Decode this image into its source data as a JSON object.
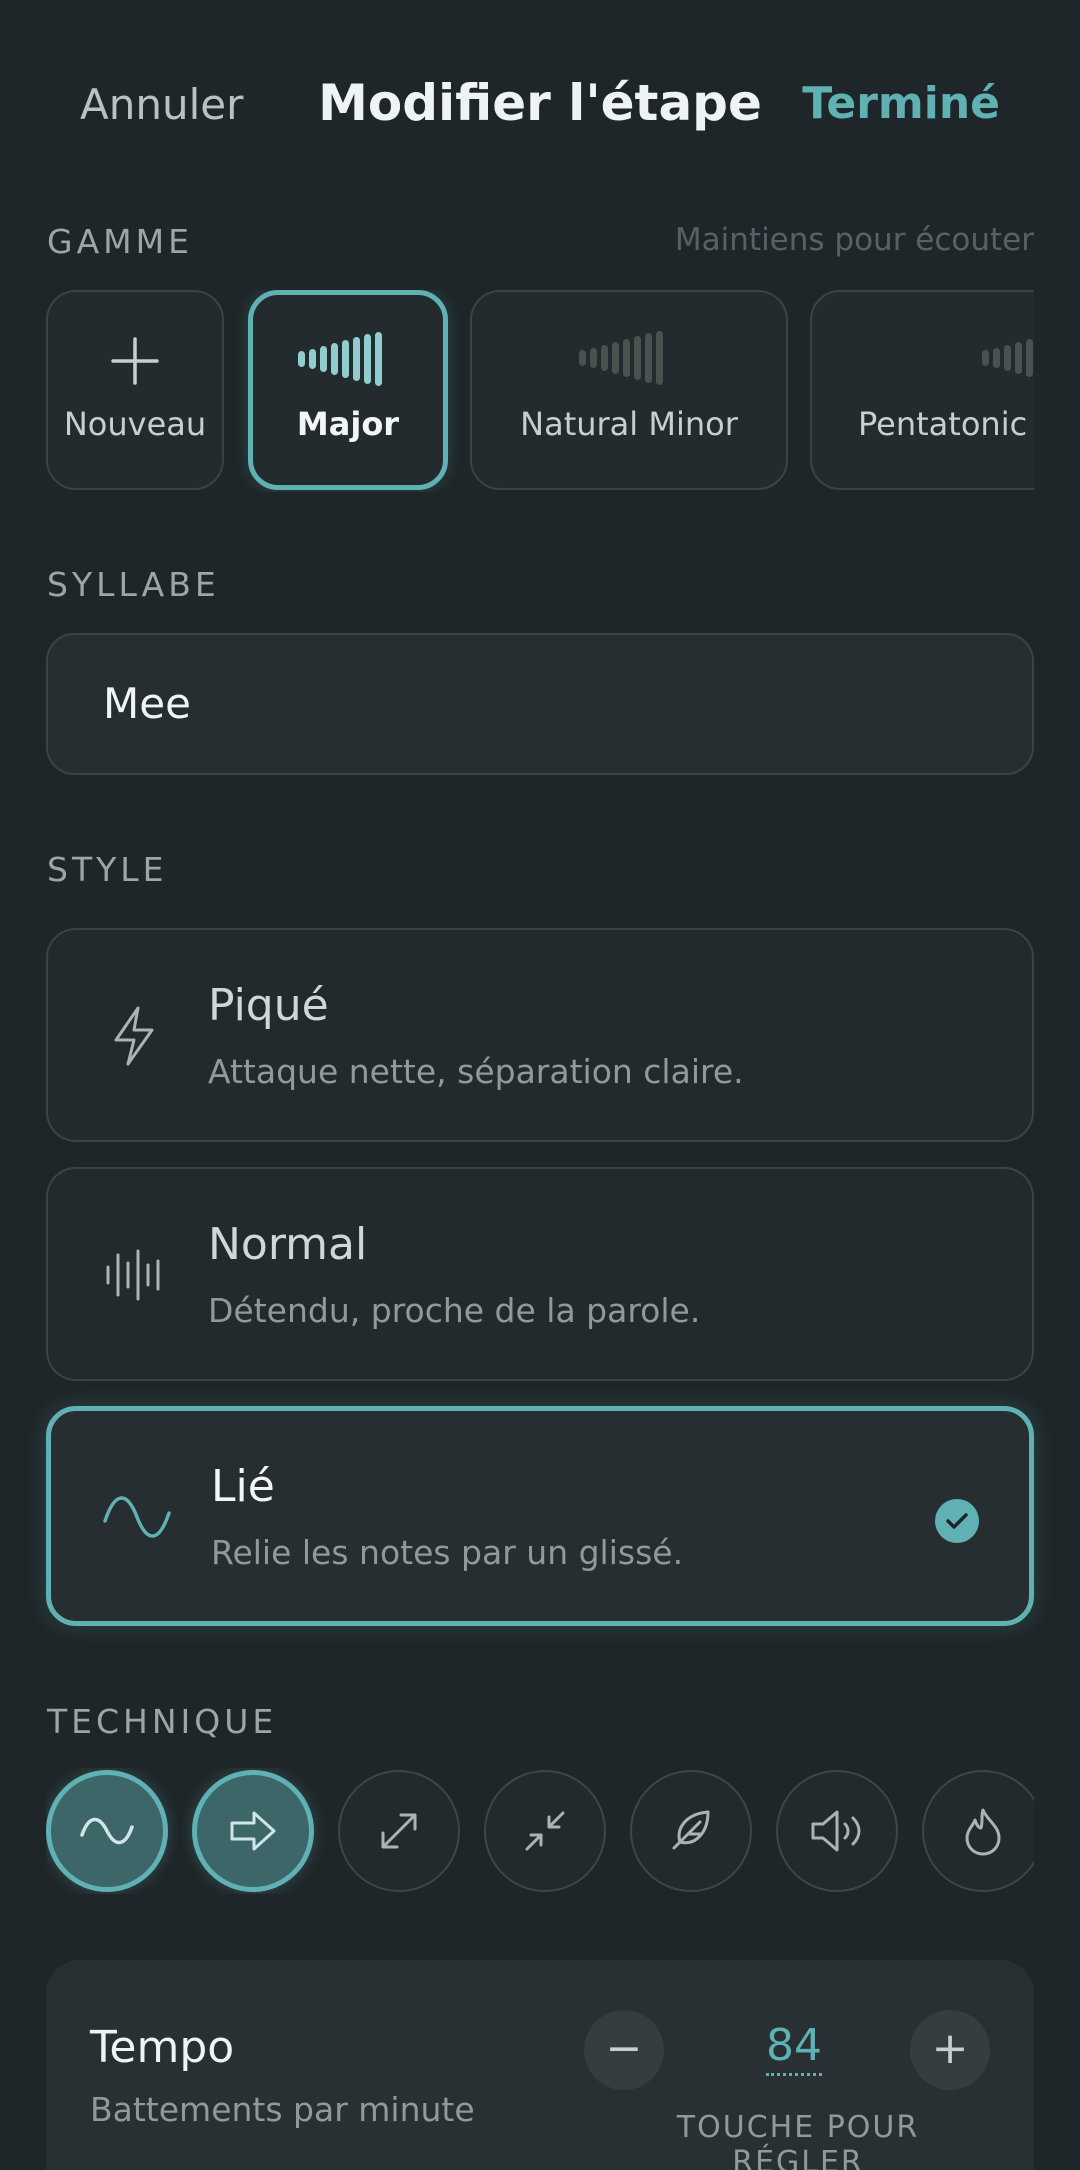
{
  "header": {
    "cancel_label": "Annuler",
    "title": "Modifier l'étape",
    "done_label": "Terminé"
  },
  "scale_section": {
    "label": "GAMME",
    "hint": "Maintiens pour écouter",
    "items": [
      {
        "label": "Nouveau",
        "icon": "plus-icon",
        "selected": false
      },
      {
        "label": "Major",
        "icon": "scale-bars-icon",
        "selected": true
      },
      {
        "label": "Natural Minor",
        "icon": "scale-bars-icon",
        "selected": false
      },
      {
        "label": "Pentatonic",
        "icon": "scale-bars-icon",
        "selected": false
      }
    ]
  },
  "syllable_section": {
    "label": "SYLLABE",
    "value": "Mee"
  },
  "style_section": {
    "label": "STYLE",
    "items": [
      {
        "name": "Piqué",
        "description": "Attaque nette, séparation claire.",
        "icon": "lightning-icon",
        "selected": false
      },
      {
        "name": "Normal",
        "description": "Détendu, proche de la parole.",
        "icon": "waveform-icon",
        "selected": false
      },
      {
        "name": "Lié",
        "description": "Relie les notes par un glissé.",
        "icon": "sine-wave-icon",
        "selected": true
      }
    ]
  },
  "technique_section": {
    "label": "TECHNIQUE",
    "items": [
      {
        "icon": "sine-wave-icon",
        "active": true
      },
      {
        "icon": "arrow-right-icon",
        "active": true
      },
      {
        "icon": "expand-icon",
        "active": false
      },
      {
        "icon": "compress-icon",
        "active": false
      },
      {
        "icon": "feather-icon",
        "active": false
      },
      {
        "icon": "speaker-icon",
        "active": false
      },
      {
        "icon": "flame-icon",
        "active": false
      }
    ]
  },
  "tempo": {
    "title": "Tempo",
    "subtitle": "Battements par minute",
    "value": "84",
    "decrement_label": "−",
    "increment_label": "+",
    "hint": "TOUCHE POUR RÉGLER"
  },
  "colors": {
    "background": "#1f2629",
    "accent": "#5fb1b3",
    "card": "#232b2e",
    "border": "#3a4447"
  }
}
